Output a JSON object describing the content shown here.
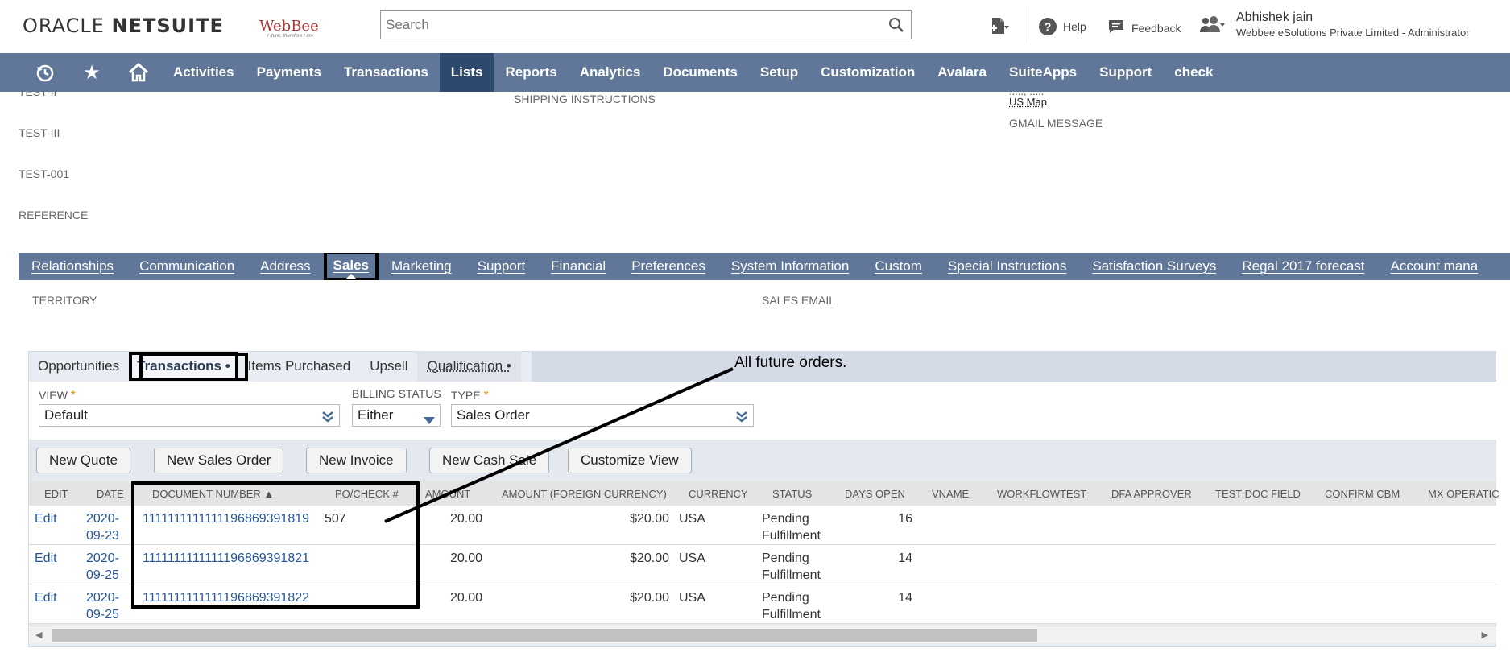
{
  "header": {
    "logo_oracle": "ORACLE",
    "logo_netsuite": "NETSUITE",
    "company_logo_text": "WebBee",
    "company_tagline": "I think, therefore I am",
    "search_placeholder": "Search",
    "help": "Help",
    "feedback": "Feedback",
    "user_name": "Abhishek jain",
    "user_role": "Webbee eSolutions Private Limited - Administrator"
  },
  "nav": {
    "items": [
      "Activities",
      "Payments",
      "Transactions",
      "Lists",
      "Reports",
      "Analytics",
      "Documents",
      "Setup",
      "Customization",
      "Avalara",
      "SuiteApps",
      "Support",
      "check"
    ],
    "active": "Lists"
  },
  "fields": {
    "left": [
      "TEST-II",
      "TEST-III",
      "TEST-001",
      "REFERENCE"
    ],
    "middle": "SHIPPING INSTRUCTIONS",
    "right_value_partial": "....., .....",
    "right_link": "US Map",
    "right_label": "GMAIL MESSAGE"
  },
  "tabs": {
    "items": [
      "Relationships",
      "Communication",
      "Address",
      "Sales",
      "Marketing",
      "Support",
      "Financial",
      "Preferences",
      "System Information",
      "Custom",
      "Special Instructions",
      "Satisfaction Surveys",
      "Regal 2017 forecast",
      "Account mana"
    ],
    "active": "Sales"
  },
  "sales": {
    "territory_label": "TERRITORY",
    "sales_email_label": "SALES EMAIL"
  },
  "subtabs": {
    "items": [
      "Opportunities",
      "Transactions •",
      "Items Purchased",
      "Upsell",
      "Qualification •"
    ],
    "active": "Transactions •"
  },
  "filters": {
    "view_label": "VIEW",
    "view_value": "Default",
    "billing_label": "BILLING STATUS",
    "billing_value": "Either",
    "type_label": "TYPE",
    "type_value": "Sales Order",
    "required_mark": "*"
  },
  "buttons": [
    "New Quote",
    "New Sales Order",
    "New Invoice",
    "New Cash Sale",
    "Customize View"
  ],
  "table": {
    "columns": [
      "EDIT",
      "DATE",
      "DOCUMENT NUMBER ▲",
      "PO/CHECK #",
      "AMOUNT",
      "AMOUNT (FOREIGN CURRENCY)",
      "CURRENCY",
      "STATUS",
      "DAYS OPEN",
      "VNAME",
      "WORKFLOWTEST",
      "DFA APPROVER",
      "TEST DOC FIELD",
      "CONFIRM CBM",
      "MX OPERATIC"
    ],
    "rows": [
      {
        "edit": "Edit",
        "date1": "2020-",
        "date2": "09-23",
        "doc": "1111111111111196869391819",
        "po": "507",
        "amount": "20.00",
        "foreign": "$20.00",
        "currency": "USA",
        "status1": "Pending",
        "status2": "Fulfillment",
        "days": "16"
      },
      {
        "edit": "Edit",
        "date1": "2020-",
        "date2": "09-25",
        "doc": "1111111111111196869391821",
        "po": "",
        "amount": "20.00",
        "foreign": "$20.00",
        "currency": "USA",
        "status1": "Pending",
        "status2": "Fulfillment",
        "days": "14"
      },
      {
        "edit": "Edit",
        "date1": "2020-",
        "date2": "09-25",
        "doc": "1111111111111196869391822",
        "po": "",
        "amount": "20.00",
        "foreign": "$20.00",
        "currency": "USA",
        "status1": "Pending",
        "status2": "Fulfillment",
        "days": "14"
      }
    ]
  },
  "annotation": {
    "note": "All future orders."
  },
  "colors": {
    "nav_bg": "#607799",
    "nav_active": "#2d4a6e",
    "link": "#255599",
    "required": "#d98a00"
  }
}
